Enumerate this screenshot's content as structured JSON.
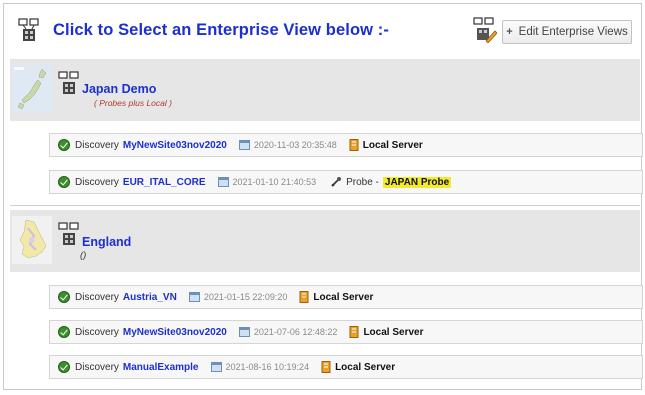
{
  "header": {
    "title": "Click to Select an Enterprise View below :-",
    "edit_button_label": "Edit Enterprise Views",
    "edit_button_icon": "plus-icon"
  },
  "colors": {
    "link_blue": "#1c2fd0",
    "group_band": "#e6e6e6",
    "ok_green": "#3b8f2d",
    "probe_highlight": "#f3ea2c",
    "subtitle_red": "#b03a2e"
  },
  "groups": [
    {
      "name": "Japan Demo",
      "subtitle": "( Probes plus Local )",
      "thumbnail_icon": "japan-map-icon",
      "discoveries": [
        {
          "label": "Discovery",
          "site": "MyNewSite03nov2020",
          "timestamp": "2020-11-03 20:35:48",
          "server_type": "local",
          "server_label": "Local Server"
        },
        {
          "label": "Discovery",
          "site": "EUR_ITAL_CORE",
          "timestamp": "2021-01-10 21:40:53",
          "server_type": "probe",
          "probe_label": "Probe -",
          "probe_name": "JAPAN Probe"
        }
      ]
    },
    {
      "name": "England",
      "subtitle": "()",
      "thumbnail_icon": "england-map-icon",
      "discoveries": [
        {
          "label": "Discovery",
          "site": "Austria_VN",
          "timestamp": "2021-01-15 22:09:20",
          "server_type": "local",
          "server_label": "Local Server"
        },
        {
          "label": "Discovery",
          "site": "MyNewSite03nov2020",
          "timestamp": "2021-07-06 12:48:22",
          "server_type": "local",
          "server_label": "Local Server"
        },
        {
          "label": "Discovery",
          "site": "ManualExample",
          "timestamp": "2021-08-16 10:19:24",
          "server_type": "local",
          "server_label": "Local Server"
        }
      ]
    }
  ]
}
